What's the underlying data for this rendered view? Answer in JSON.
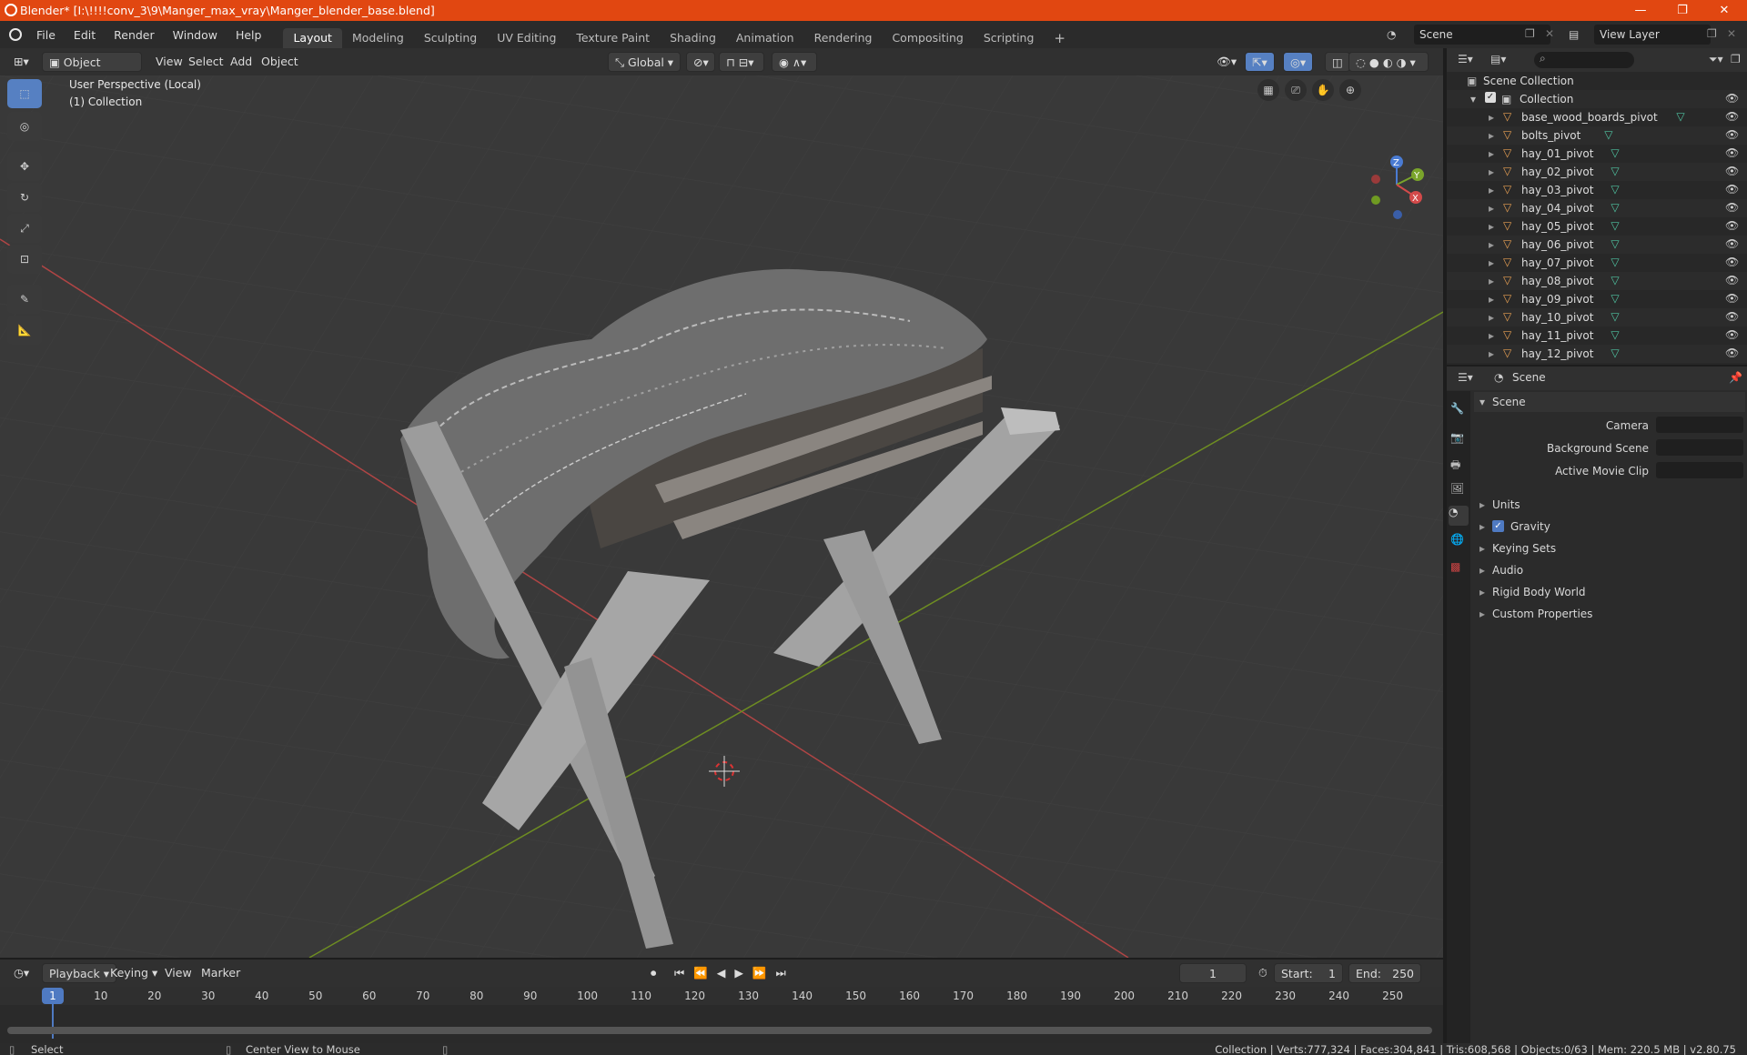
{
  "window": {
    "title": "Blender* [I:\\!!!!conv_3\\9\\Manger_max_vray\\Manger_blender_base.blend]",
    "minimize": "—",
    "maximize": "❐",
    "close": "✕"
  },
  "menu": [
    "File",
    "Edit",
    "Render",
    "Window",
    "Help"
  ],
  "workspaces": [
    "Layout",
    "Modeling",
    "Sculpting",
    "UV Editing",
    "Texture Paint",
    "Shading",
    "Animation",
    "Rendering",
    "Compositing",
    "Scripting"
  ],
  "scene_selector": "Scene",
  "view_layer_selector": "View Layer",
  "viewport_header": {
    "mode": "Object Mode",
    "menus": [
      "View",
      "Select",
      "Add",
      "Object"
    ],
    "orientation": "Global"
  },
  "viewport": {
    "perspective": "User Perspective (Local)",
    "collection": "(1) Collection",
    "gizmo": {
      "z": "Z",
      "y": "Y",
      "x": "X"
    }
  },
  "outliner": {
    "root": "Scene Collection",
    "collection": "Collection",
    "objects": [
      "base_wood_boards_pivot",
      "bolts_pivot",
      "hay_01_pivot",
      "hay_02_pivot",
      "hay_03_pivot",
      "hay_04_pivot",
      "hay_05_pivot",
      "hay_06_pivot",
      "hay_07_pivot",
      "hay_08_pivot",
      "hay_09_pivot",
      "hay_10_pivot",
      "hay_11_pivot",
      "hay_12_pivot"
    ]
  },
  "properties": {
    "context": "Scene",
    "panel": "Scene",
    "camera_label": "Camera",
    "background_scene_label": "Background Scene",
    "active_clip_label": "Active Movie Clip",
    "sections": [
      "Units",
      "Gravity",
      "Keying Sets",
      "Audio",
      "Rigid Body World",
      "Custom Properties"
    ]
  },
  "timeline": {
    "menus": [
      "Playback",
      "Keying",
      "View",
      "Marker"
    ],
    "current_frame": "1",
    "start_label": "Start:",
    "start": "1",
    "end_label": "End:",
    "end": "250",
    "ruler": [
      "10",
      "20",
      "30",
      "40",
      "50",
      "60",
      "70",
      "80",
      "90",
      "100",
      "110",
      "120",
      "130",
      "140",
      "150",
      "160",
      "170",
      "180",
      "190",
      "200",
      "210",
      "220",
      "230",
      "240",
      "250"
    ],
    "playhead": "1"
  },
  "status": {
    "select": "Select",
    "center": "Center View to Mouse",
    "stats": "Collection | Verts:777,324 | Faces:304,841 | Tris:608,568 | Objects:0/63 | Mem: 220.5 MB | v2.80.75"
  },
  "colors": {
    "title_bar": "#e14711",
    "accent": "#5680c2",
    "x_axis": "#c84b4b",
    "y_axis": "#7a9c2a"
  }
}
